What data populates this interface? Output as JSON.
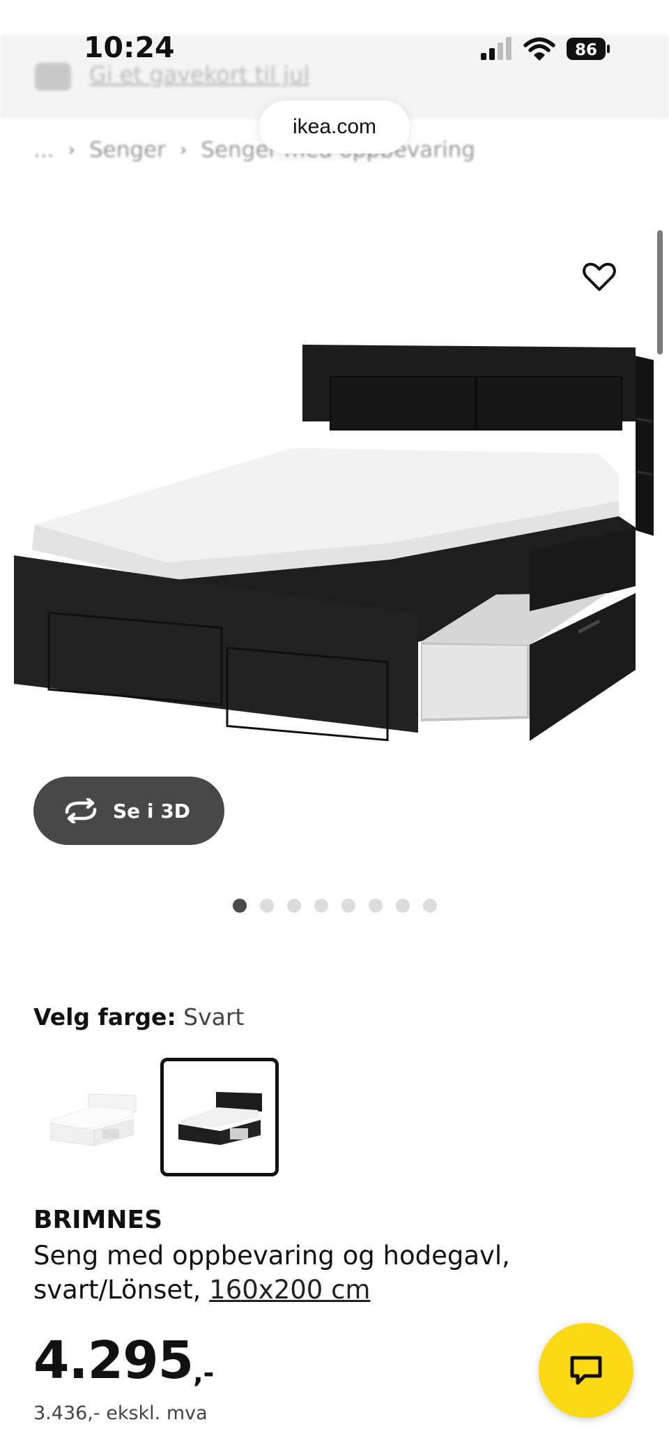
{
  "status_bar": {
    "time": "10:24",
    "battery": "86",
    "icons": [
      "signal-icon",
      "wifi-icon",
      "battery-icon"
    ]
  },
  "banner": {
    "icon": "gift-card-icon",
    "text": "Gi et gavekort til jul"
  },
  "browser": {
    "url": "ikea.com"
  },
  "breadcrumb": {
    "items": [
      "...",
      "Senger",
      "Senger med oppbevaring"
    ]
  },
  "gallery": {
    "favorite_icon": "heart-icon",
    "view_3d_label": "Se i 3D",
    "view_3d_icon": "rotate-3d-icon",
    "image_count": 8,
    "active_index": 0
  },
  "color": {
    "label": "Velg farge:",
    "value": "Svart",
    "options": [
      "Hvit",
      "Svart"
    ],
    "selected_index": 1
  },
  "product": {
    "brand": "BRIMNES",
    "description": "Seng med oppbevaring og hodegavl, svart/Lönset,",
    "size": "160x200 cm",
    "price": "4.295",
    "price_suffix": ",-",
    "price_ex_vat": "3.436,- ekskl. mva"
  },
  "chat": {
    "icon": "chat-bubble-icon"
  },
  "colors": {
    "brand_yellow": "#FBD914",
    "button_dark": "#484848",
    "text": "#111111",
    "dot_active": "#4a4a4a",
    "dot_inactive": "#dcdcdc"
  }
}
